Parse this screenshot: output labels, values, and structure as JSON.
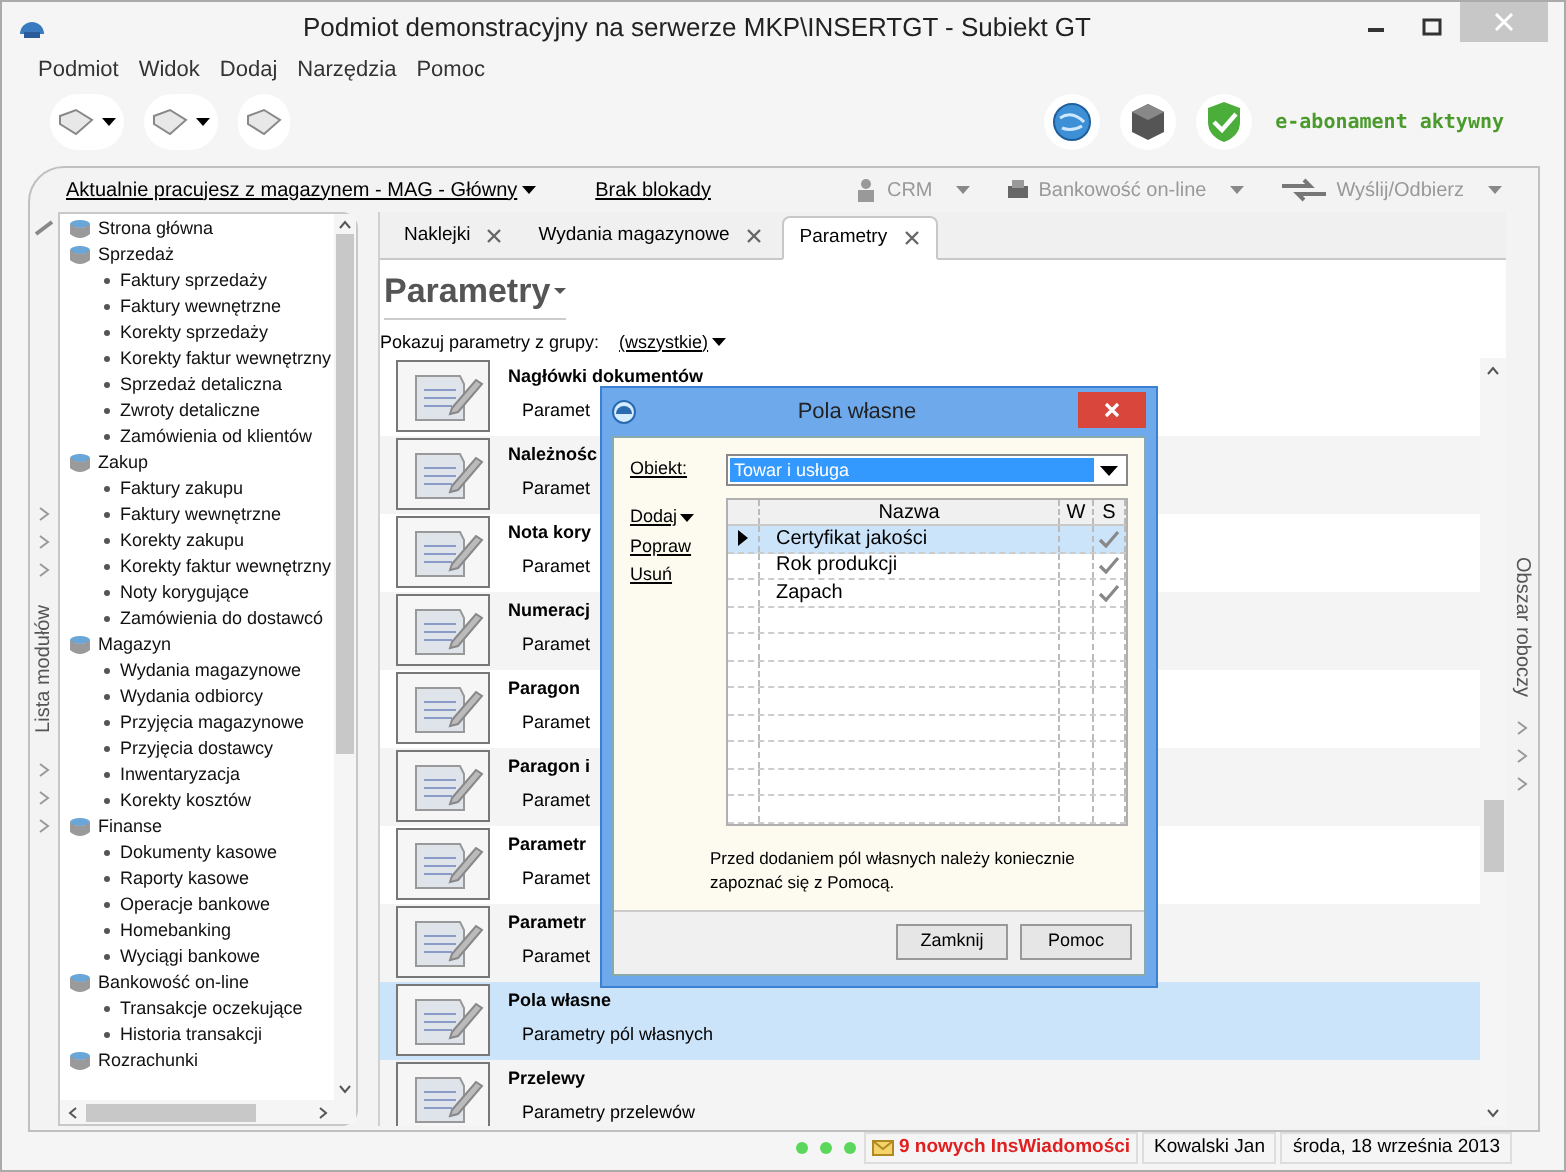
{
  "window": {
    "title": "Podmiot demonstracyjny na serwerze MKP\\INSERTGT - Subiekt GT"
  },
  "menu": [
    "Podmiot",
    "Widok",
    "Dodaj",
    "Narzędzia",
    "Pomoc"
  ],
  "subscription": "e-abonament aktywny",
  "infobar": {
    "warehouse": "Aktualnie pracujesz z magazynem - MAG - Główny",
    "lock": "Brak blokady",
    "actions": [
      "CRM",
      "Bankowość on-line",
      "Wyślij/Odbierz"
    ]
  },
  "sidebar": {
    "label": "Lista modułów",
    "items": [
      {
        "label": "Strona główna"
      },
      {
        "label": "Sprzedaż",
        "children": [
          {
            "label": "Faktury sprzedaży"
          },
          {
            "label": "Faktury wewnętrzne"
          },
          {
            "label": "Korekty sprzedaży"
          },
          {
            "label": "Korekty faktur wewnętrzny"
          },
          {
            "label": "Sprzedaż detaliczna"
          },
          {
            "label": "Zwroty detaliczne"
          },
          {
            "label": "Zamówienia od klientów"
          }
        ]
      },
      {
        "label": "Zakup",
        "children": [
          {
            "label": "Faktury zakupu"
          },
          {
            "label": "Faktury wewnętrzne"
          },
          {
            "label": "Korekty zakupu"
          },
          {
            "label": "Korekty faktur wewnętrzny"
          },
          {
            "label": "Noty korygujące"
          },
          {
            "label": "Zamówienia do dostawcó"
          }
        ]
      },
      {
        "label": "Magazyn",
        "children": [
          {
            "label": "Wydania magazynowe"
          },
          {
            "label": "Wydania odbiorcy"
          },
          {
            "label": "Przyjęcia magazynowe"
          },
          {
            "label": "Przyjęcia dostawcy"
          },
          {
            "label": "Inwentaryzacja"
          },
          {
            "label": "Korekty kosztów"
          }
        ]
      },
      {
        "label": "Finanse",
        "children": [
          {
            "label": "Dokumenty kasowe"
          },
          {
            "label": "Raporty kasowe"
          },
          {
            "label": "Operacje bankowe"
          },
          {
            "label": "Homebanking"
          },
          {
            "label": "Wyciągi bankowe"
          }
        ]
      },
      {
        "label": "Bankowość on-line",
        "children": [
          {
            "label": "Transakcje oczekujące"
          },
          {
            "label": "Historia transakcji"
          }
        ]
      },
      {
        "label": "Rozrachunki"
      }
    ]
  },
  "workspace_label": "Obszar roboczy",
  "tabs": [
    {
      "label": "Naklejki",
      "selected": false
    },
    {
      "label": "Wydania magazynowe",
      "selected": false
    },
    {
      "label": "Parametry",
      "selected": true
    }
  ],
  "page_title": "Parametry",
  "group_filter": {
    "label": "Pokazuj parametry z grupy:",
    "value": "(wszystkie)"
  },
  "parameters": [
    {
      "title": "Nagłówki dokumentów",
      "subtitle": "Paramet",
      "selected": false
    },
    {
      "title": "Należnośc",
      "subtitle": "Paramet",
      "selected": false
    },
    {
      "title": "Nota kory",
      "subtitle": "Paramet",
      "selected": false
    },
    {
      "title": "Numeracj",
      "subtitle": "Paramet",
      "selected": false
    },
    {
      "title": "Paragon",
      "subtitle": "Paramet",
      "selected": false
    },
    {
      "title": "Paragon i",
      "subtitle": "Paramet",
      "selected": false
    },
    {
      "title": "Parametr",
      "subtitle": "Paramet",
      "selected": false
    },
    {
      "title": "Parametr",
      "subtitle": "Paramet",
      "selected": false
    },
    {
      "title": "Pola własne",
      "subtitle": "Parametry pól własnych",
      "selected": true
    },
    {
      "title": "Przelewy",
      "subtitle": "Parametry przelewów",
      "selected": false
    }
  ],
  "dialog": {
    "title": "Pola własne",
    "object_label": "Obiekt:",
    "object_value": "Towar i usługa",
    "actions": [
      "Dodaj",
      "Popraw",
      "Usuń"
    ],
    "columns": [
      "Nazwa",
      "W",
      "S"
    ],
    "rows": [
      {
        "name": "Certyfikat jakości",
        "w": false,
        "s": true,
        "selected": true
      },
      {
        "name": "Rok produkcji",
        "w": false,
        "s": true,
        "selected": false
      },
      {
        "name": "Zapach",
        "w": false,
        "s": true,
        "selected": false
      }
    ],
    "note": "Przed dodaniem pól własnych należy koniecznie zapoznać się z Pomocą.",
    "buttons": [
      "Zamknij",
      "Pomoc"
    ]
  },
  "status_bar": {
    "messages": "9 nowych InsWiadomości",
    "user": "Kowalski Jan",
    "date": "środa, 18 września 2013"
  }
}
